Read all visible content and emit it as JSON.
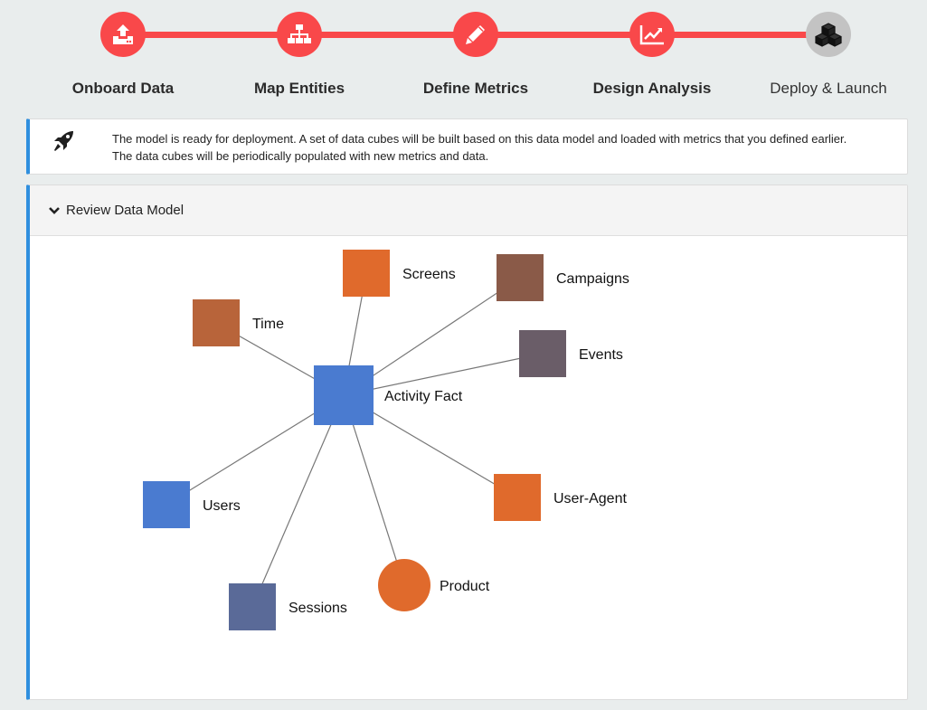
{
  "wizard": {
    "steps": [
      {
        "label": "Onboard Data",
        "icon": "upload-icon",
        "state": "done"
      },
      {
        "label": "Map Entities",
        "icon": "sitemap-icon",
        "state": "done"
      },
      {
        "label": "Define Metrics",
        "icon": "pencil-icon",
        "state": "done"
      },
      {
        "label": "Design Analysis",
        "icon": "line-chart-icon",
        "state": "done"
      },
      {
        "label": "Deploy & Launch",
        "icon": "cubes-icon",
        "state": "current"
      }
    ],
    "colors": {
      "done": "#f9484a",
      "current": "#c3c3c3"
    }
  },
  "info": {
    "icon": "rocket-icon",
    "text": "The model is ready for deployment. A set of data cubes will be built based on this data model and loaded with metrics that you defined earlier. The data cubes will be periodically populated with new metrics and data."
  },
  "review_panel": {
    "title": "Review Data Model",
    "icon": "chevron-down-icon",
    "accent": "#2f8fde"
  },
  "data_model": {
    "center": {
      "label": "Activity Fact",
      "shape": "square",
      "color": "#4a7bd0"
    },
    "dimensions": [
      {
        "label": "Screens",
        "shape": "square",
        "color": "#e06a2c"
      },
      {
        "label": "Campaigns",
        "shape": "square",
        "color": "#8a5a48"
      },
      {
        "label": "Time",
        "shape": "square",
        "color": "#b8643a"
      },
      {
        "label": "Events",
        "shape": "square",
        "color": "#6a5d68"
      },
      {
        "label": "Users",
        "shape": "square",
        "color": "#4a7bd0"
      },
      {
        "label": "User-Agent",
        "shape": "square",
        "color": "#e06a2c"
      },
      {
        "label": "Product",
        "shape": "circle",
        "color": "#e06a2c"
      },
      {
        "label": "Sessions",
        "shape": "square",
        "color": "#5a6a98"
      }
    ]
  }
}
